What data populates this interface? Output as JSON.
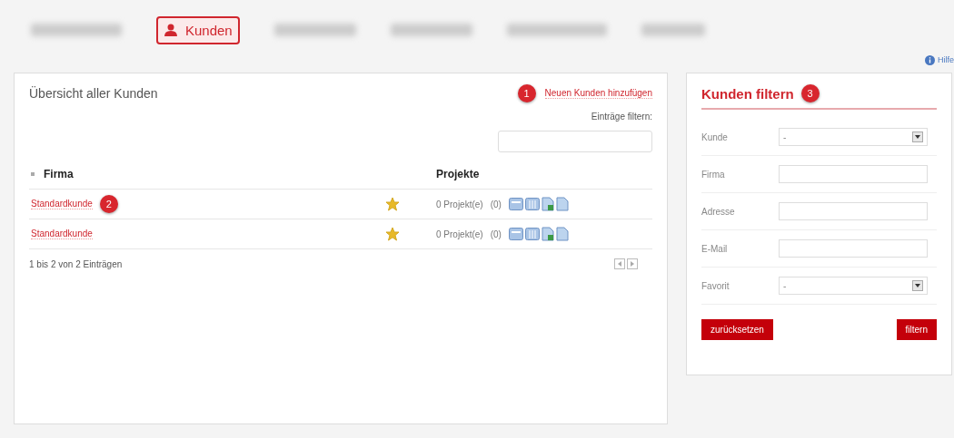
{
  "nav": {
    "tabs": [
      {
        "kind": "blurred",
        "selected": false
      },
      {
        "kind": "text",
        "label": "Kunden",
        "selected": true
      },
      {
        "kind": "blurred",
        "selected": false
      },
      {
        "kind": "blurred",
        "selected": false
      },
      {
        "kind": "blurred",
        "selected": false
      },
      {
        "kind": "blurred",
        "selected": false
      }
    ],
    "help": "Hilfe"
  },
  "main": {
    "title": "Übersicht aller Kunden",
    "add_link": "Neuen Kunden hinzufügen",
    "add_badge": "1",
    "filter_label": "Einträge filtern:",
    "columns": [
      "Firma",
      "Projekte"
    ],
    "rows": [
      {
        "firma": "Standardkunde",
        "badge": "2",
        "favorite": true,
        "projects": "0 Projekt(e)",
        "count": "(0)"
      },
      {
        "firma": "Standardkunde",
        "favorite": true,
        "projects": "0 Projekt(e)",
        "count": "(0)"
      }
    ],
    "info": "1 bis 2 von 2 Einträgen"
  },
  "filter": {
    "title": "Kunden filtern",
    "badge": "3",
    "fields": [
      {
        "label": "Kunde",
        "kind": "select",
        "value": "-"
      },
      {
        "label": "Firma",
        "kind": "text"
      },
      {
        "label": "Adresse",
        "kind": "text"
      },
      {
        "label": "E-Mail",
        "kind": "text"
      },
      {
        "label": "Favorit",
        "kind": "select",
        "value": "-"
      }
    ],
    "reset": "zurücksetzen",
    "submit": "filtern"
  }
}
